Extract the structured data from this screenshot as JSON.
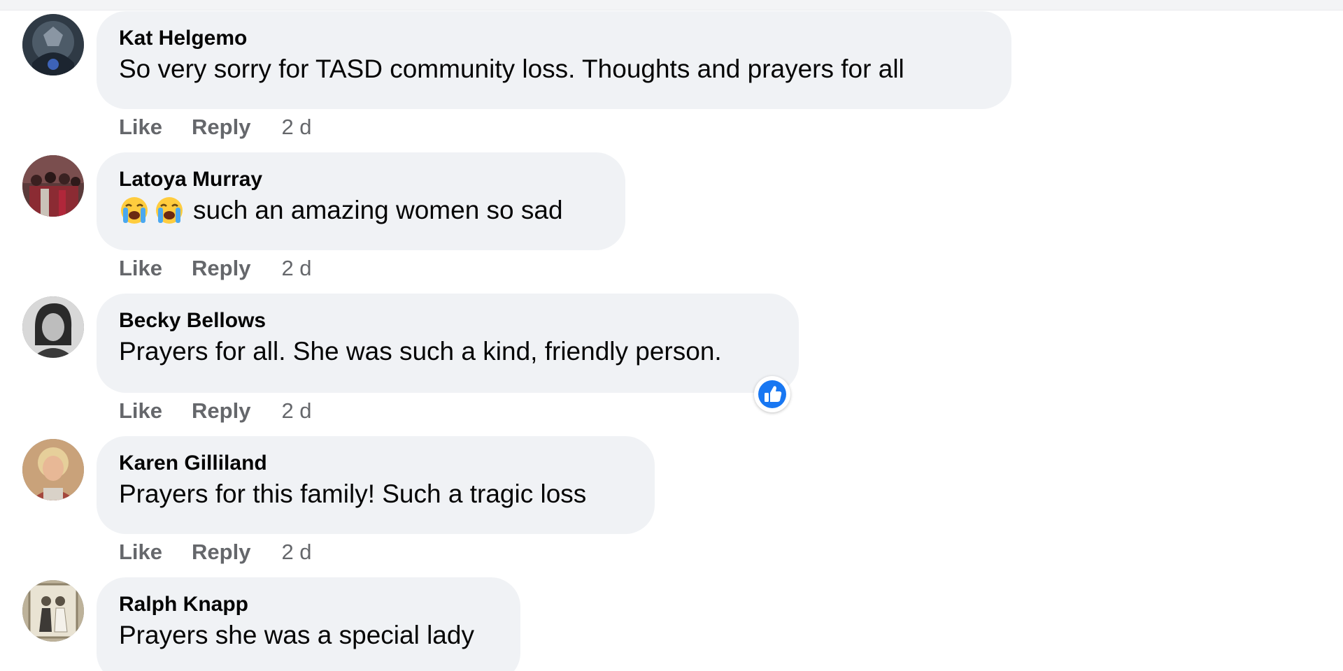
{
  "colors": {
    "bubble_bg": "#f0f2f5",
    "author_text": "#050505",
    "meta_text": "#65676b",
    "like_reaction": "#1877f2"
  },
  "comments": [
    {
      "author": "Kat Helgemo",
      "text": "So very sorry for TASD community loss. Thoughts and prayers for all",
      "like_label": "Like",
      "reply_label": "Reply",
      "time": "2 d",
      "avatar_icon": "profile-photo"
    },
    {
      "author": "Latoya Murray",
      "emojis": [
        "loudly-crying-face",
        "loudly-crying-face"
      ],
      "text": "such an amazing women so sad",
      "like_label": "Like",
      "reply_label": "Reply",
      "time": "2 d",
      "avatar_icon": "profile-photo"
    },
    {
      "author": "Becky Bellows",
      "text": "Prayers for all. She was such a kind, friendly person.",
      "like_label": "Like",
      "reply_label": "Reply",
      "time": "2 d",
      "avatar_icon": "profile-photo",
      "reaction": "like-reaction-icon"
    },
    {
      "author": "Karen Gilliland",
      "text": "Prayers for this family! Such a tragic loss",
      "like_label": "Like",
      "reply_label": "Reply",
      "time": "2 d",
      "avatar_icon": "profile-photo"
    },
    {
      "author": "Ralph Knapp",
      "text": "Prayers she was a special lady",
      "avatar_icon": "profile-photo"
    }
  ]
}
